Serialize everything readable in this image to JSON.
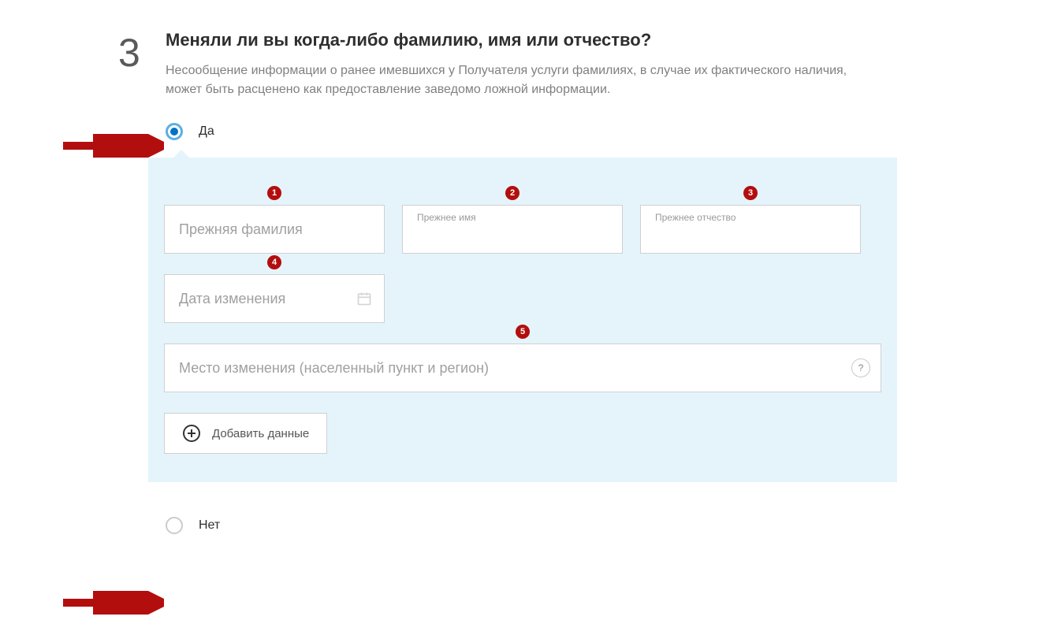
{
  "step_number": "3",
  "question": "Меняли ли вы когда-либо фамилию, имя или отчество?",
  "hint": "Несообщение информации о ранее имевшихся у Получателя услуги фамилиях, в случае их фактического наличия, может быть расценено как предоставление заведомо ложной информации.",
  "radio_yes": "Да",
  "radio_no": "Нет",
  "fields": {
    "prev_surname": {
      "placeholder": "Прежняя фамилия",
      "badge": "1"
    },
    "prev_name": {
      "label": "Прежнее имя",
      "badge": "2"
    },
    "prev_patronymic": {
      "label": "Прежнее отчество",
      "badge": "3"
    },
    "date": {
      "placeholder": "Дата изменения",
      "badge": "4"
    },
    "place": {
      "placeholder": "Место изменения (населенный пункт и регион)",
      "badge": "5"
    }
  },
  "add_button": "Добавить данные",
  "help_symbol": "?"
}
